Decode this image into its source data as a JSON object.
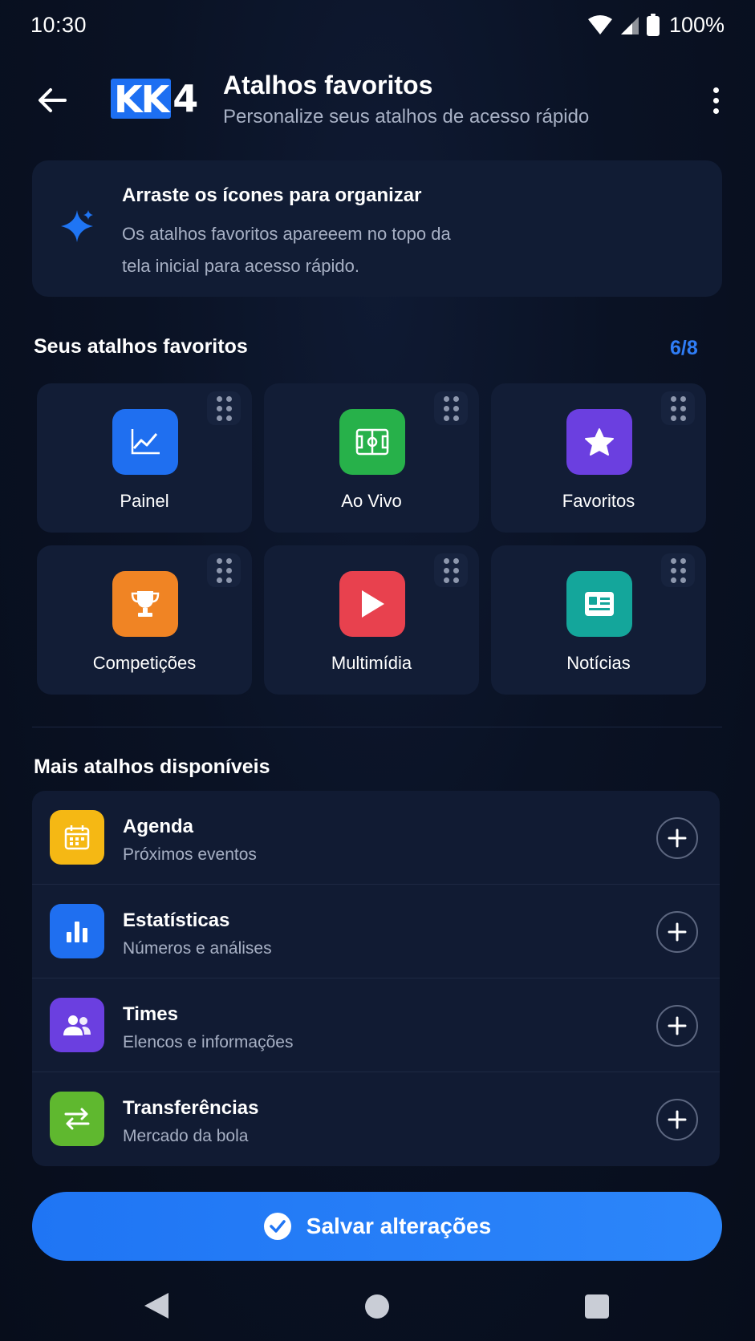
{
  "status_bar": {
    "time": "10:30",
    "battery": "100%"
  },
  "header": {
    "logo_kk": "KK",
    "logo_4": "4",
    "title": "Atalhos favoritos",
    "subtitle": "Personalize seus atalhos de acesso rápido"
  },
  "info": {
    "title": "Arraste os ícones para organizar",
    "text": "Os atalhos favoritos apareeem no topo da tela inicial para acesso rápido."
  },
  "favorites": {
    "title": "Seus atalhos favoritos",
    "count": "6/8",
    "items": [
      {
        "label": "Painel",
        "icon": "chart-line-icon",
        "color": "#1f6ff0"
      },
      {
        "label": "Ao Vivo",
        "icon": "football-field-icon",
        "color": "#27b14a"
      },
      {
        "label": "Favoritos",
        "icon": "star-icon",
        "color": "#6b3fe0"
      },
      {
        "label": "Competições",
        "icon": "trophy-icon",
        "color": "#f08424"
      },
      {
        "label": "Multimídia",
        "icon": "play-icon",
        "color": "#e8414e"
      },
      {
        "label": "Notícias",
        "icon": "newspaper-icon",
        "color": "#14a69b"
      }
    ]
  },
  "more": {
    "title": "Mais atalhos disponíveis",
    "items": [
      {
        "title": "Agenda",
        "subtitle": "Próximos eventos",
        "icon": "calendar-icon",
        "color": "#f5b814"
      },
      {
        "title": "Estatísticas",
        "subtitle": "Números e análises",
        "icon": "bar-chart-icon",
        "color": "#1f6ff0"
      },
      {
        "title": "Times",
        "subtitle": "Elencos e informações",
        "icon": "users-icon",
        "color": "#6b3fe0"
      },
      {
        "title": "Transferências",
        "subtitle": "Mercado da bola",
        "icon": "transfer-arrows-icon",
        "color": "#5fb82f"
      }
    ]
  },
  "save_label": "Salvar alterações"
}
